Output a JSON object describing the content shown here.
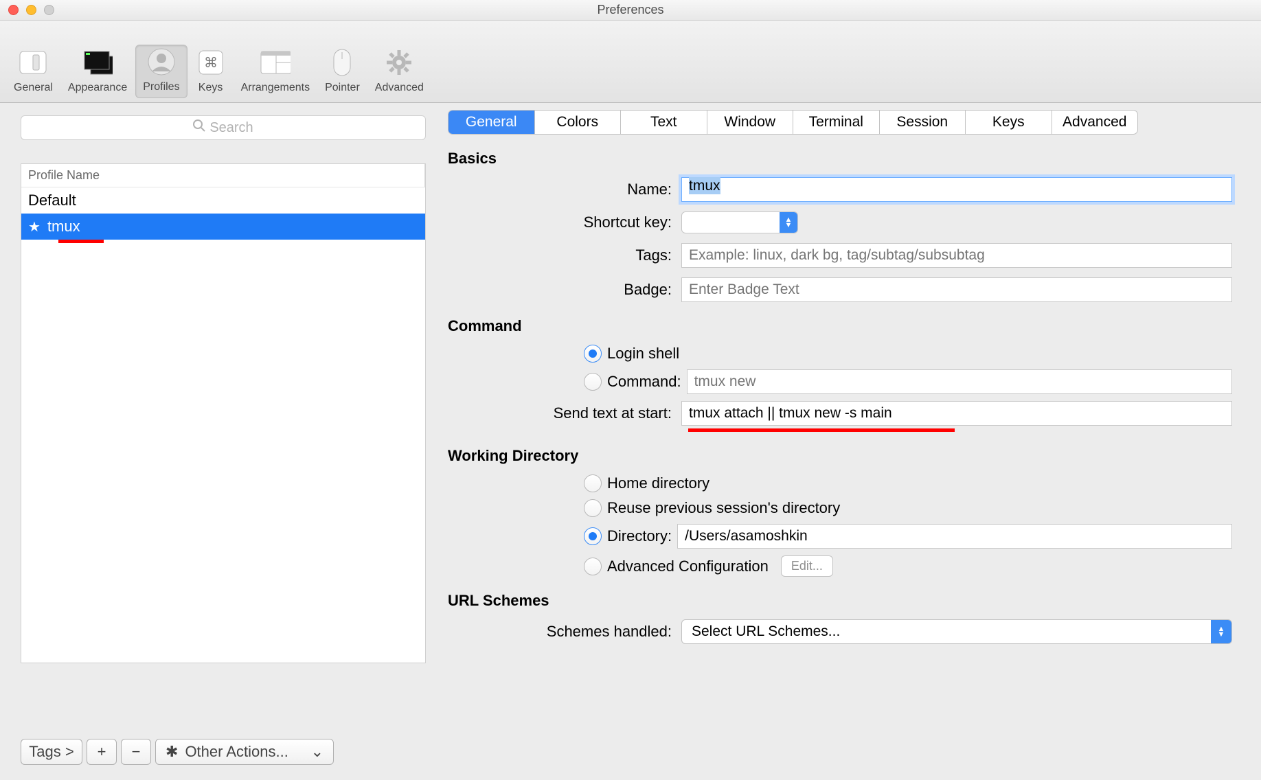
{
  "window_title": "Preferences",
  "toolbar": {
    "items": [
      {
        "label": "General"
      },
      {
        "label": "Appearance"
      },
      {
        "label": "Profiles"
      },
      {
        "label": "Keys"
      },
      {
        "label": "Arrangements"
      },
      {
        "label": "Pointer"
      },
      {
        "label": "Advanced"
      }
    ]
  },
  "sidebar": {
    "search_placeholder": "Search",
    "header": "Profile Name",
    "profiles": [
      {
        "name": "Default",
        "default": false,
        "selected": false
      },
      {
        "name": "tmux",
        "default": true,
        "selected": true
      }
    ],
    "footer": {
      "tags_label": "Tags >",
      "other_actions_label": "Other Actions..."
    }
  },
  "subtabs": [
    "General",
    "Colors",
    "Text",
    "Window",
    "Terminal",
    "Session",
    "Keys",
    "Advanced"
  ],
  "main": {
    "sections": {
      "basics": "Basics",
      "command": "Command",
      "workdir": "Working Directory",
      "url": "URL Schemes"
    },
    "name_label": "Name:",
    "name_value": "tmux",
    "shortcut_label": "Shortcut key:",
    "tags_label": "Tags:",
    "tags_placeholder": "Example: linux, dark bg, tag/subtag/subsubtag",
    "badge_label": "Badge:",
    "badge_placeholder": "Enter Badge Text",
    "login_shell_label": "Login shell",
    "command_label": "Command:",
    "command_placeholder": "tmux new",
    "send_text_label": "Send text at start:",
    "send_text_value": "tmux attach || tmux new -s main",
    "home_dir_label": "Home directory",
    "reuse_label": "Reuse previous session's directory",
    "directory_label": "Directory:",
    "directory_value": "/Users/asamoshkin",
    "adv_conf_label": "Advanced Configuration",
    "edit_label": "Edit...",
    "schemes_label": "Schemes handled:",
    "schemes_value": "Select URL Schemes..."
  }
}
